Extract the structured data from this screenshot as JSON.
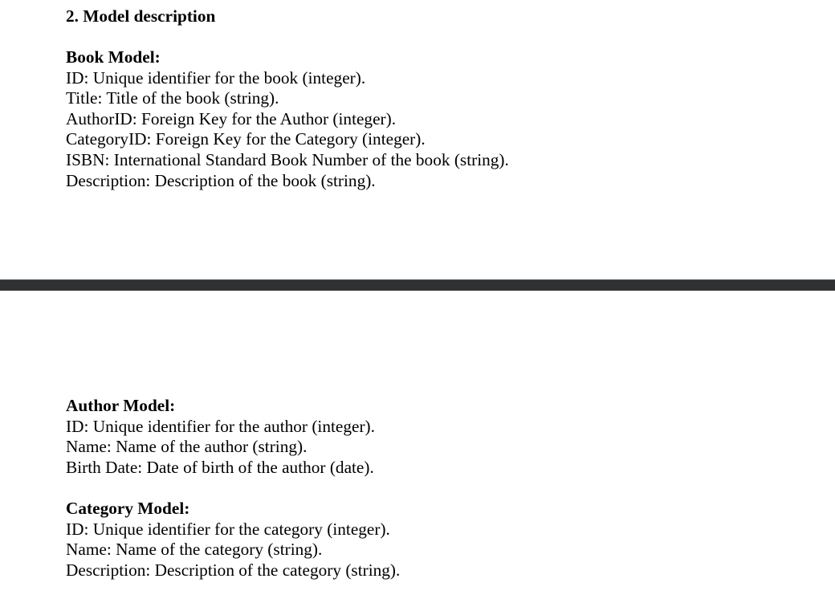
{
  "section_heading": "2. Model description",
  "book_model": {
    "title": "Book Model:",
    "lines": [
      "ID: Unique identifier for the book (integer).",
      "Title: Title of the book (string).",
      "AuthorID: Foreign Key for the Author (integer).",
      "CategoryID: Foreign Key for the Category (integer).",
      "ISBN: International Standard Book Number of the book (string).",
      "Description: Description of the book (string)."
    ]
  },
  "author_model": {
    "title": "Author Model:",
    "lines": [
      "ID: Unique identifier for the author (integer).",
      "Name: Name of the author (string).",
      "Birth Date: Date of birth of the author (date)."
    ]
  },
  "category_model": {
    "title": "Category Model:",
    "lines": [
      "ID: Unique identifier for the category (integer).",
      "Name: Name of the category (string).",
      "Description: Description of the category (string)."
    ]
  }
}
